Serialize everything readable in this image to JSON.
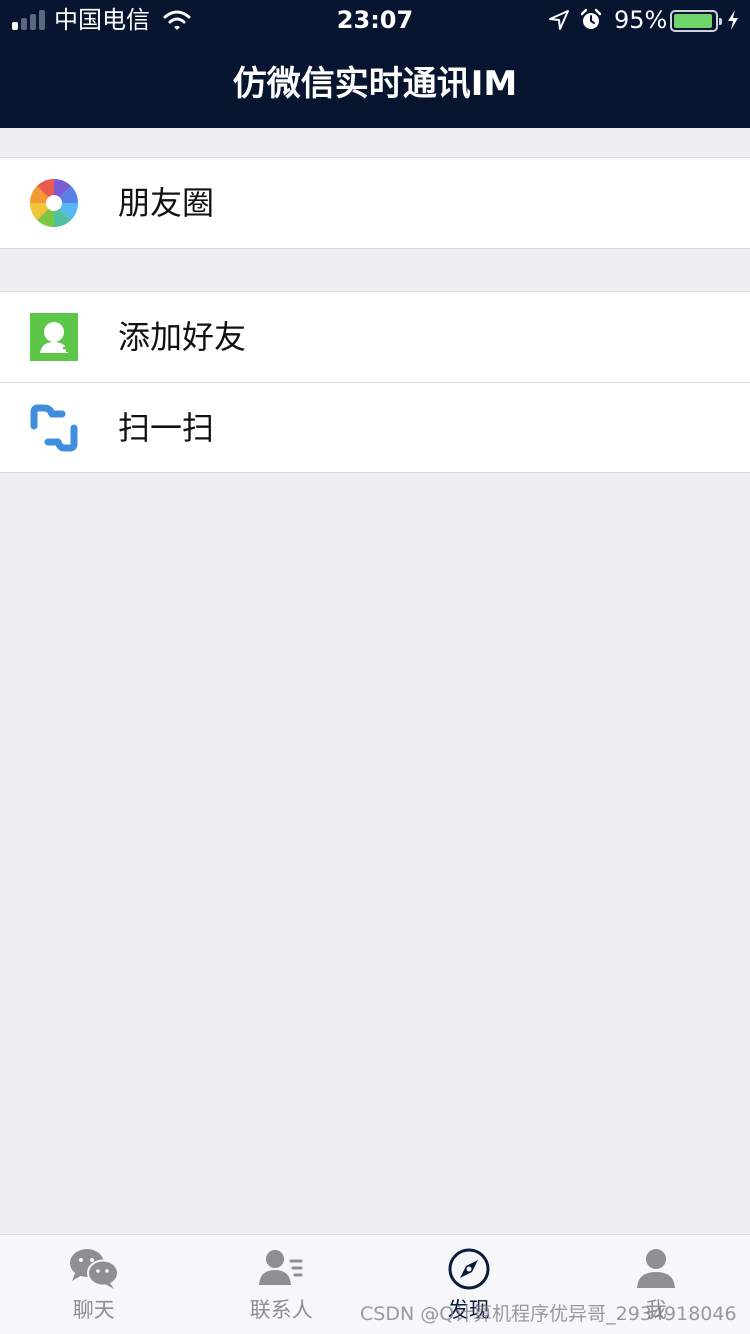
{
  "status_bar": {
    "carrier": "中国电信",
    "time": "23:07",
    "battery_percent": "95%",
    "battery_level": 0.95,
    "icons": [
      "signal-icon",
      "wifi-icon",
      "location-arrow-icon",
      "alarm-icon",
      "battery-icon",
      "charging-bolt-icon"
    ]
  },
  "nav": {
    "title": "仿微信实时通讯IM",
    "background": "#081530"
  },
  "groups": [
    {
      "items": [
        {
          "label": "朋友圈",
          "icon": "moments-aperture-icon"
        }
      ]
    },
    {
      "items": [
        {
          "label": "添加好友",
          "icon": "add-friend-icon",
          "icon_color": "#5cc648"
        },
        {
          "label": "扫一扫",
          "icon": "scan-icon",
          "icon_color": "#3f8fdc"
        }
      ]
    }
  ],
  "tabbar": {
    "tabs": [
      {
        "label": "聊天",
        "icon": "chat-bubbles-icon",
        "active": false
      },
      {
        "label": "联系人",
        "icon": "contacts-icon",
        "active": false
      },
      {
        "label": "发现",
        "icon": "compass-icon",
        "active": true
      },
      {
        "label": "我",
        "icon": "person-icon",
        "active": false
      }
    ]
  },
  "watermark": "CSDN @Q计算机程序优异哥_2934918046"
}
